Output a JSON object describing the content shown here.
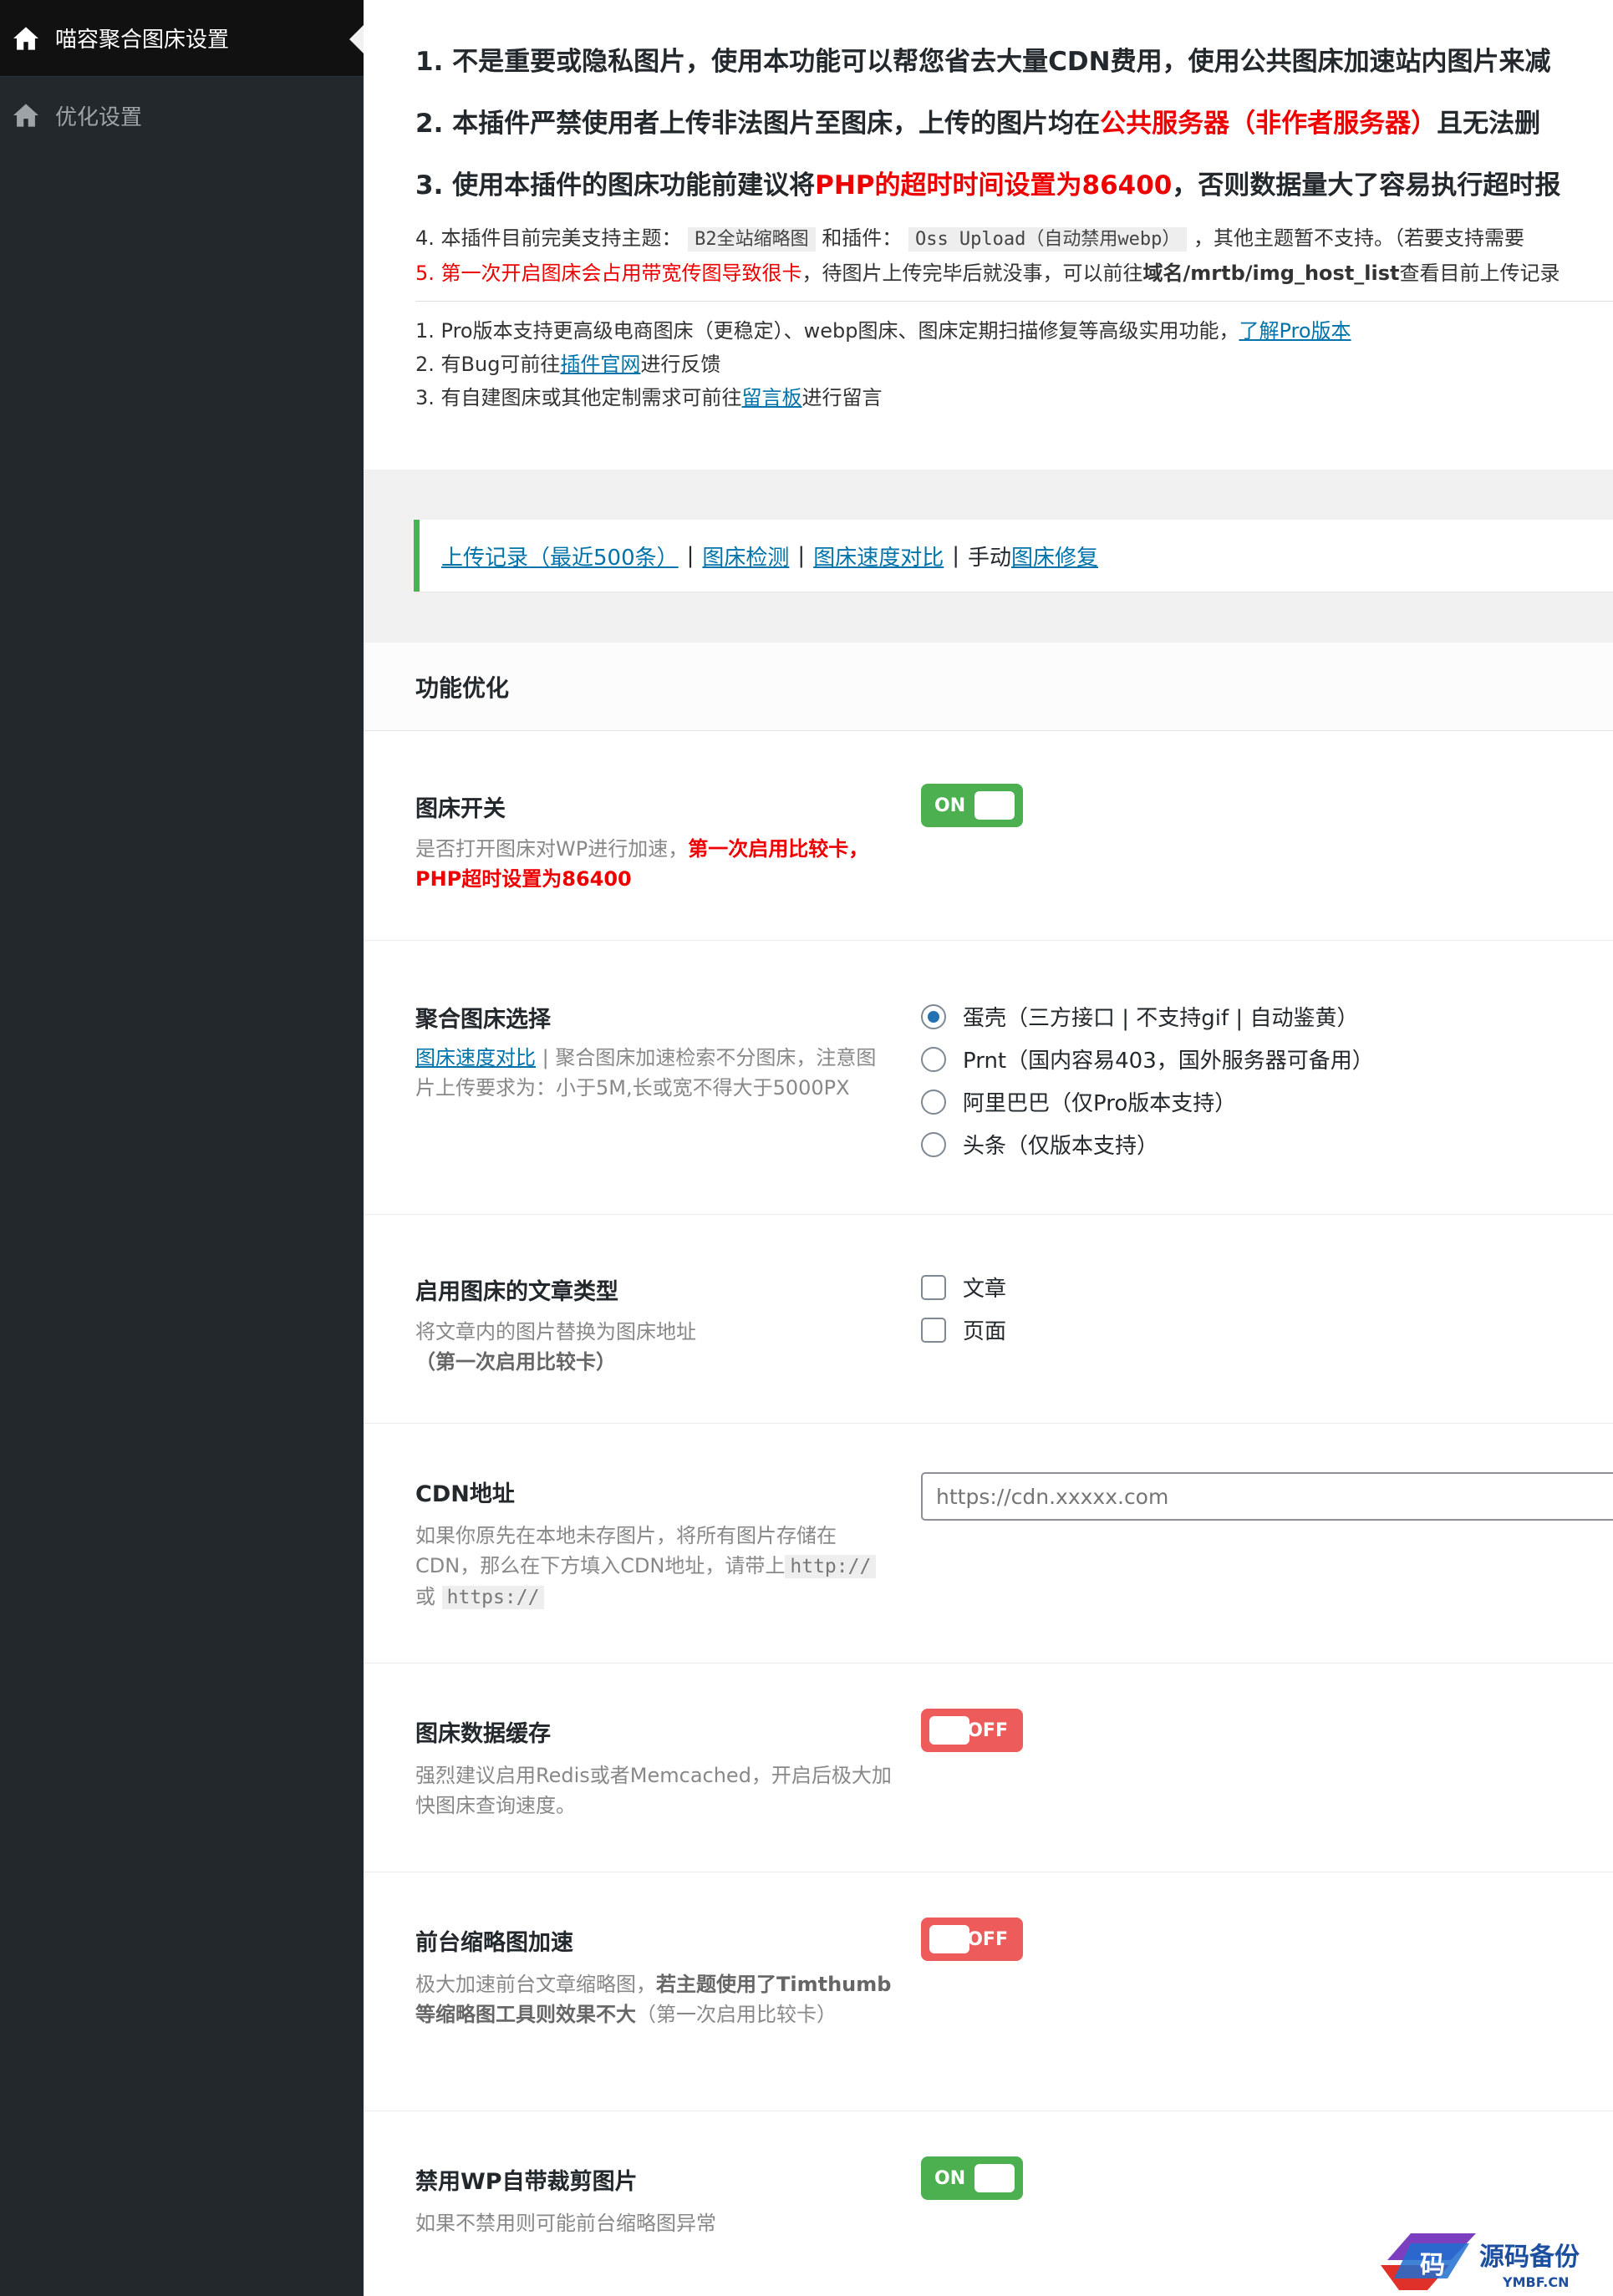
{
  "sidebar": {
    "items": [
      {
        "label": "喵容聚合图床设置",
        "active": true
      },
      {
        "label": "优化设置",
        "active": false
      }
    ]
  },
  "notice": {
    "line1": "1. 不是重要或隐私图片，使用本功能可以帮您省去大量CDN费用，使用公共图床加速站内图片来减",
    "line2_a": "2. 本插件严禁使用者上传非法图片至图床，上传的图片均在",
    "line2_b": "公共服务器（非作者服务器）",
    "line2_c": "且无法删",
    "line3_a": "3. 使用本插件的图床功能前建议将",
    "line3_b": "PHP的超时时间设置为86400",
    "line3_c": "，否则数据量大了容易执行超时报",
    "line4_a": "4. 本插件目前完美支持主题：",
    "line4_code1": "B2全站缩略图",
    "line4_b": "和插件：",
    "line4_code2": "Oss Upload（自动禁用webp）",
    "line4_c": "，其他主题暂不支持。（若要支持需要",
    "line5_a": "5. 第一次开启图床会占用带宽传图导致很卡",
    "line5_b": "，待图片上传完毕后就没事，可以前往",
    "line5_c": "域名/mrtb/img_host_list",
    "line5_d": "查看目前上传记录",
    "pro1_a": "1. Pro版本支持更高级电商图床（更稳定）、webp图床、图床定期扫描修复等高级实用功能，",
    "pro1_link": "了解Pro版本",
    "pro2_a": "2. 有Bug可前往",
    "pro2_link": "插件官网",
    "pro2_b": "进行反馈",
    "pro3_a": "3. 有自建图床或其他定制需求可前往",
    "pro3_link": "留言板",
    "pro3_b": "进行留言"
  },
  "linkbar": {
    "link1": "上传记录（最近500条）",
    "sep": "|",
    "link2": "图床检测",
    "link3": "图床速度对比",
    "manual": "手动",
    "link4": "图床修复"
  },
  "panel": {
    "title": "功能优化",
    "switch": {
      "label": "图床开关",
      "desc_a": "是否打开图床对WP进行加速，",
      "desc_b": "第一次启用比较卡，PHP超时设置为86400",
      "state": "ON"
    },
    "host": {
      "label": "聚合图床选择",
      "desc_link": "图床速度对比",
      "desc_b": "| 聚合图床加速检索不分图床，注意图片上传要求为：小于5M,长或宽不得大于5000PX",
      "options": [
        {
          "label": "蛋壳（三方接口 | 不支持gif | 自动鉴黄）",
          "checked": true
        },
        {
          "label": "Prnt（国内容易403，国外服务器可备用）",
          "checked": false
        },
        {
          "label": "阿里巴巴（仅Pro版本支持）",
          "checked": false
        },
        {
          "label": "头条（仅版本支持）",
          "checked": false
        }
      ]
    },
    "types": {
      "label": "启用图床的文章类型",
      "desc_a": "将文章内的图片替换为图床地址",
      "desc_b": "（第一次启用比较卡）",
      "options": [
        {
          "label": "文章",
          "checked": false
        },
        {
          "label": "页面",
          "checked": false
        }
      ]
    },
    "cdn": {
      "label": "CDN地址",
      "desc_a": "如果你原先在本地未存图片，将所有图片存储在CDN，那么在下方填入CDN地址，请带上",
      "code1": "http://",
      "or": "或",
      "code2": "https://",
      "placeholder": "https://cdn.xxxxx.com"
    },
    "cache": {
      "label": "图床数据缓存",
      "desc": "强烈建议启用Redis或者Memcached，开启后极大加快图床查询速度。",
      "state": "OFF"
    },
    "thumb": {
      "label": "前台缩略图加速",
      "desc_a": "极大加速前台文章缩略图，",
      "desc_b": "若主题使用了Timthumb等缩略图工具则效果不大",
      "desc_c": "（第一次启用比较卡）",
      "state": "OFF"
    },
    "crop": {
      "label": "禁用WP自带裁剪图片",
      "desc": "如果不禁用则可能前台缩略图异常",
      "state": "ON"
    }
  },
  "watermark": {
    "text": "源码备份",
    "sub": "YMBF.CN",
    "glyph": "码"
  },
  "colors": {
    "sidebar_bg": "#23282d",
    "accent": "#0073aa",
    "on": "#4cb050",
    "off": "#ee5b5b",
    "red": "#ee0000"
  }
}
